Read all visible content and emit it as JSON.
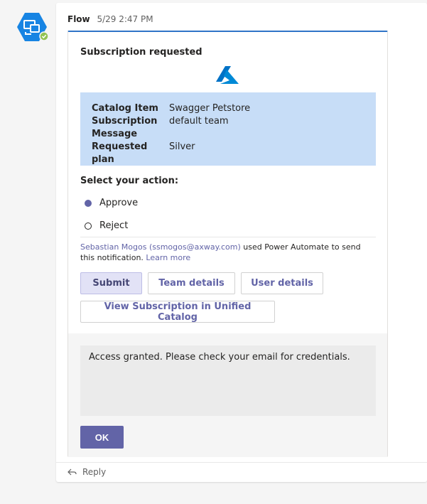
{
  "message": {
    "sender": "Flow",
    "timestamp": "5/29 2:47 PM"
  },
  "card": {
    "title": "Subscription requested",
    "facts": [
      {
        "key": "Catalog Item",
        "value": "Swagger Petstore"
      },
      {
        "key": "Subscription",
        "value": "default team"
      },
      {
        "key": "Message",
        "value": ""
      },
      {
        "key": "Requested plan",
        "value": "Silver"
      }
    ],
    "action_label": "Select your action:",
    "options": [
      {
        "label": "Approve",
        "selected": true
      },
      {
        "label": "Reject",
        "selected": false
      }
    ],
    "notification": {
      "sender_link": "Sebastian Mogos (ssmogos@axway.com)",
      "text": " used Power Automate to send this notification. ",
      "learn_more": "Learn more"
    },
    "buttons": {
      "submit": "Submit",
      "team_details": "Team details",
      "user_details": "User details",
      "view_subscription": "View Subscription in Unified Catalog"
    },
    "response": {
      "text": "Access granted. Please check your email for credentials.",
      "ok_label": "OK"
    }
  },
  "reply": {
    "label": "Reply"
  },
  "icons": {
    "avatar": "power-automate-bot-icon",
    "status": "available-check-icon",
    "logo": "azure-logo-icon",
    "reply": "reply-arrow-icon"
  },
  "colors": {
    "accent": "#6264a7",
    "card_top_border": "#2f74c7",
    "fact_background": "#c7ddf7",
    "avatar_blue": "#1784e3",
    "status_green": "#92c353"
  }
}
